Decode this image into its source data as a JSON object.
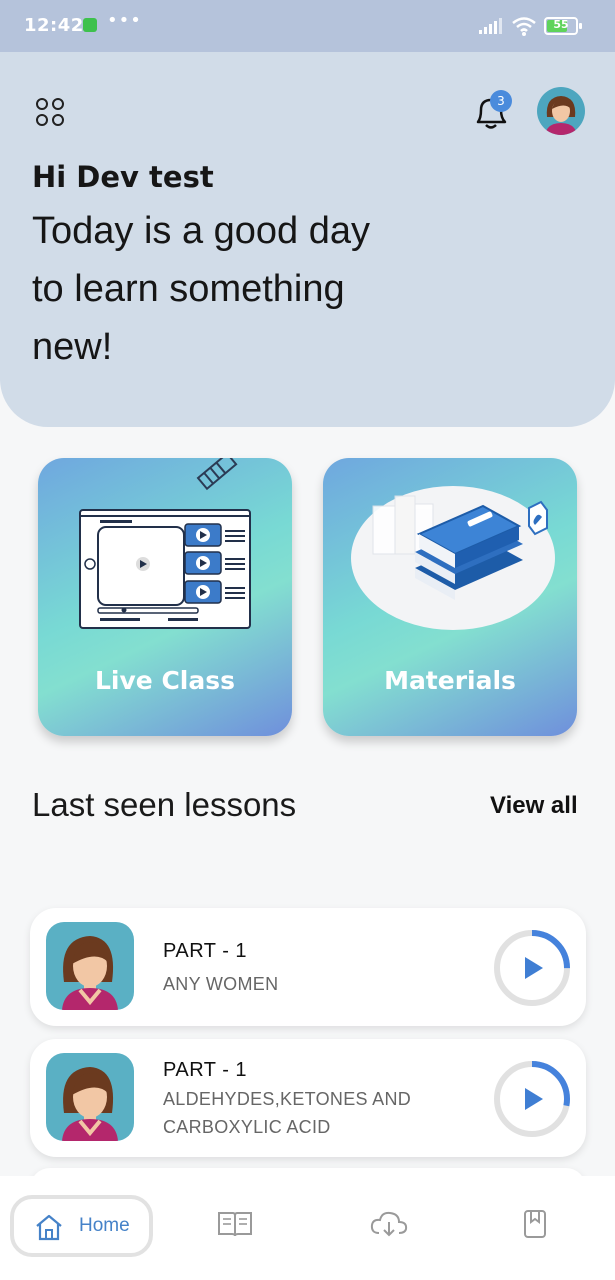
{
  "status_bar": {
    "time": "12:42",
    "dots": "•••",
    "battery": "55"
  },
  "header": {
    "greeting": "Hi Dev test",
    "tagline": "Today is a good day  to learn something new!",
    "notification_count": "3"
  },
  "tiles": {
    "live_class": "Live Class",
    "materials": "Materials"
  },
  "section": {
    "title": "Last seen lessons",
    "view_all": "View all"
  },
  "lessons": [
    {
      "title": "PART - 1",
      "subtitle": "ANY WOMEN",
      "progress": 0.25
    },
    {
      "title": "PART - 1",
      "subtitle": "ALDEHYDES,KETONES AND CARBOXYLIC ACID",
      "progress": 0.28
    }
  ],
  "bottom_nav": {
    "home": "Home",
    "items": [
      "home-icon",
      "book-icon",
      "cloud-download-icon",
      "bookmark-icon"
    ]
  },
  "colors": {
    "status_bar": "#b5c3db",
    "header_bg": "#d1dce8",
    "accent": "#4582c8",
    "badge": "#4a8bdc"
  }
}
